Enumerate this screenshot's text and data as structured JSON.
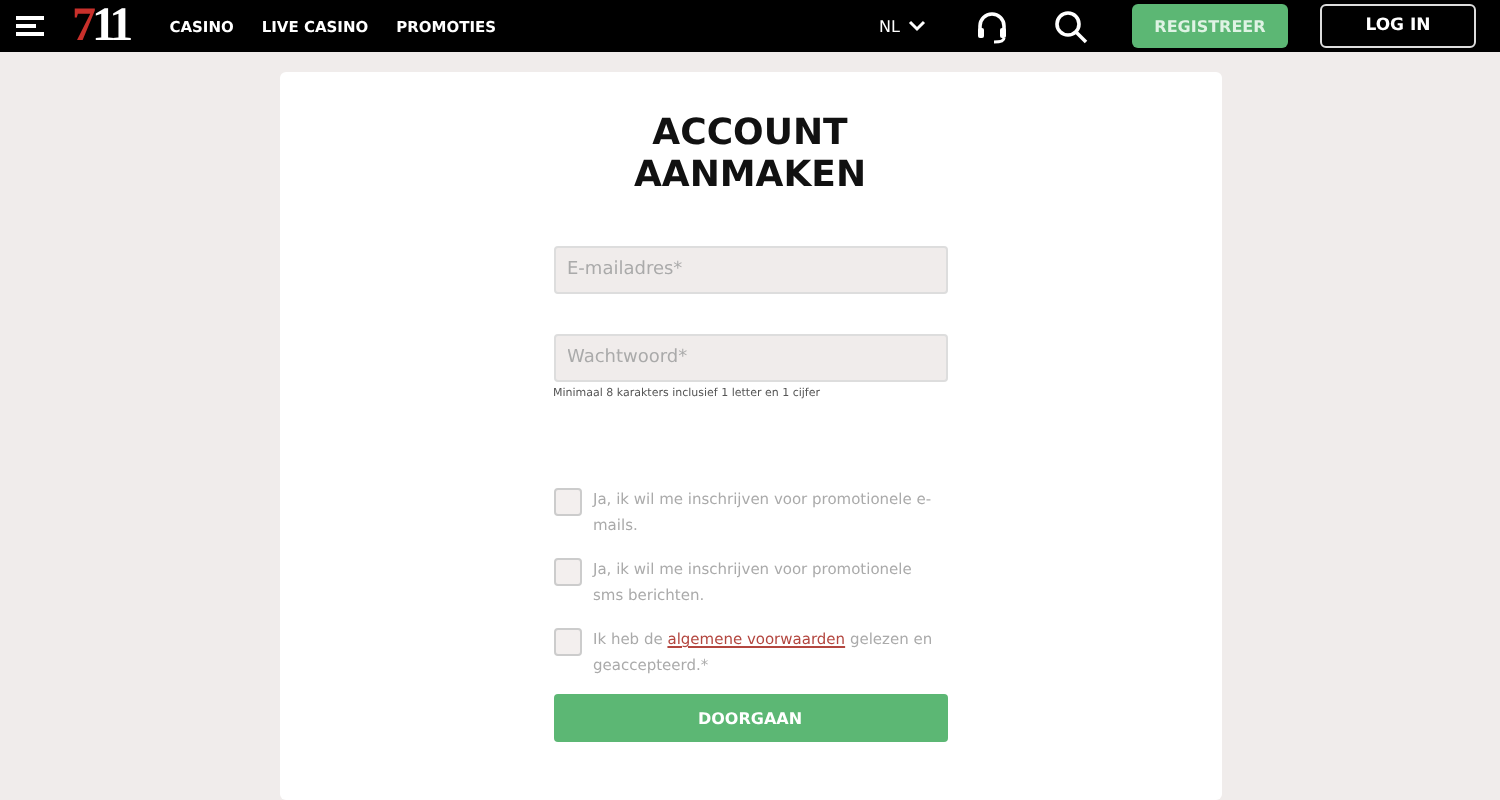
{
  "header": {
    "logo": {
      "first": "7",
      "rest": "11"
    },
    "nav": [
      "CASINO",
      "LIVE CASINO",
      "PROMOTIES"
    ],
    "language": "NL",
    "register": "REGISTREER",
    "login": "LOG IN"
  },
  "form": {
    "title_lines": [
      "ACCOUNT",
      "AANMAKEN"
    ],
    "fields": [
      {
        "placeholder": "E-mailadres*"
      },
      {
        "placeholder": "Wachtwoord*",
        "hint": "Minimaal 8 karakters inclusief 1 letter en 1 cijfer"
      }
    ],
    "checkboxes": [
      {
        "text": "Ja, ik wil me inschrijven voor promotionele e-mails.",
        "checked": false
      },
      {
        "text": "Ja, ik wil me inschrijven voor promotionele sms berichten.",
        "checked": false
      },
      {
        "text": "Ik heb de ",
        "link": "algemene voorwaarden",
        "after": " gelezen en geaccepteerd.*",
        "checked": false
      }
    ],
    "submit": "DOORGAAN"
  }
}
